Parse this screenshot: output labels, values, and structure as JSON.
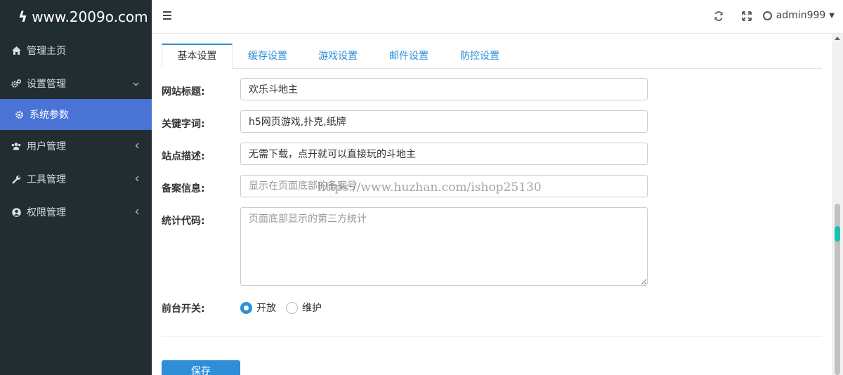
{
  "brand": {
    "logo_text": "www.2009o.com",
    "bolt_icon": "lightning-icon"
  },
  "sidebar": {
    "items": [
      {
        "label": "管理主页",
        "icon": "home-icon"
      },
      {
        "label": "设置管理",
        "icon": "gears-icon",
        "arrow": "chevron-down-icon"
      },
      {
        "label": "系统参数",
        "icon": "gear-icon"
      },
      {
        "label": "用户管理",
        "icon": "users-icon",
        "arrow": "chevron-left-icon"
      },
      {
        "label": "工具管理",
        "icon": "wrench-icon",
        "arrow": "chevron-left-icon"
      },
      {
        "label": "权限管理",
        "icon": "user-circle-icon",
        "arrow": "chevron-left-icon"
      }
    ],
    "active_index": 2
  },
  "topbar": {
    "username": "admin999"
  },
  "tabs": [
    {
      "label": "基本设置"
    },
    {
      "label": "缓存设置"
    },
    {
      "label": "游戏设置"
    },
    {
      "label": "邮件设置"
    },
    {
      "label": "防控设置"
    }
  ],
  "form": {
    "site_title": {
      "label": "网站标题:",
      "value": "欢乐斗地主"
    },
    "keywords": {
      "label": "关键字词:",
      "value": "h5网页游戏,扑克,纸牌"
    },
    "description": {
      "label": "站点描述:",
      "value": "无需下载，点开就可以直接玩的斗地主"
    },
    "icp": {
      "label": "备案信息:",
      "placeholder": "显示在页面底部的备案号"
    },
    "stats": {
      "label": "统计代码:",
      "placeholder": "页面底部显示的第三方统计"
    },
    "switch": {
      "label": "前台开关:",
      "options": [
        "开放",
        "维护"
      ],
      "selected": "开放"
    }
  },
  "save_label": "保存",
  "watermark": "https://www.huzhan.com/ishop25130",
  "colors": {
    "sidebar_bg": "#222d32",
    "active_item": "#4a73d6",
    "accent": "#2e8fd8"
  }
}
